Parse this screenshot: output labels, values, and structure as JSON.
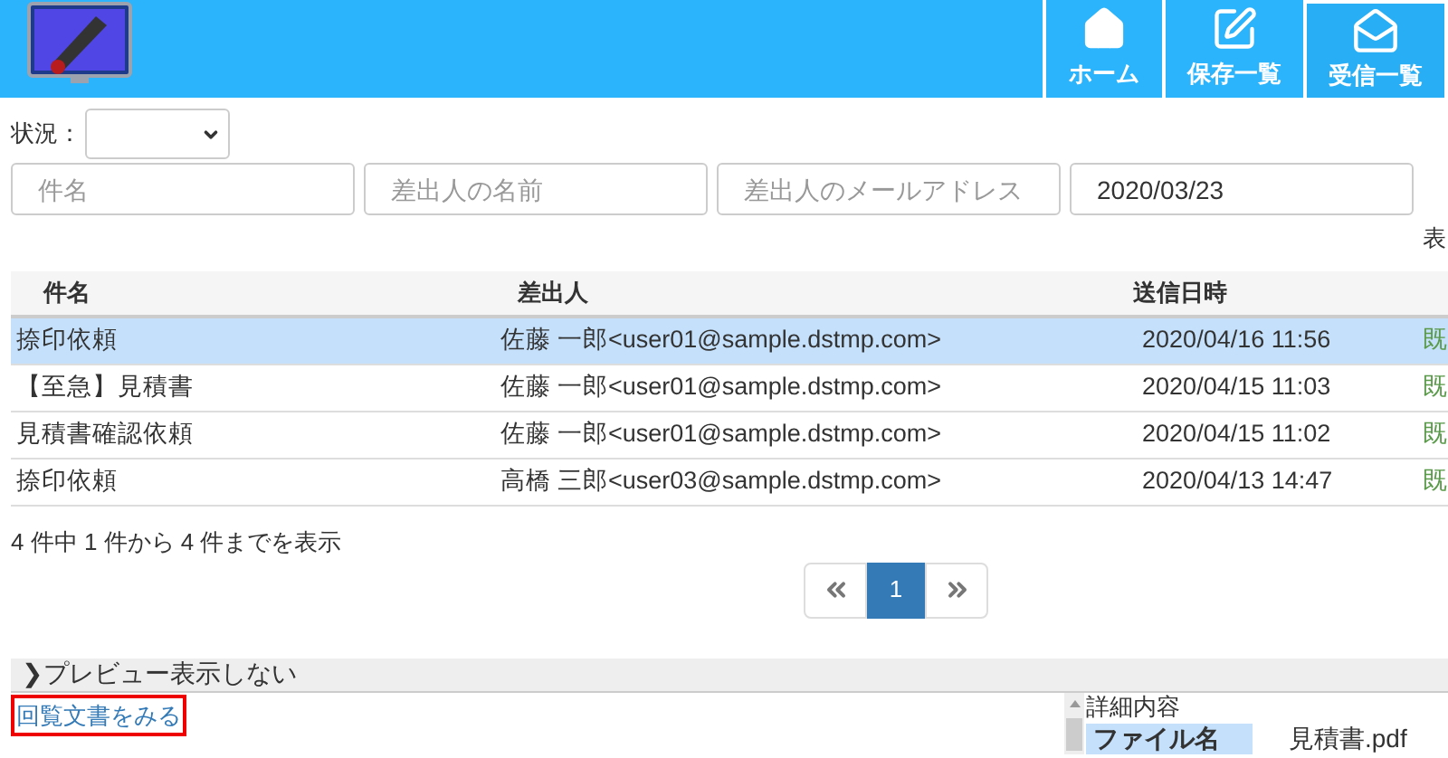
{
  "nav": [
    {
      "kind": "home",
      "label": "ホーム",
      "selected": false
    },
    {
      "kind": "edit",
      "label": "保存一覧",
      "selected": false
    },
    {
      "kind": "inbox",
      "label": "受信一覧",
      "selected": true
    }
  ],
  "status_filter": {
    "label": "状況："
  },
  "search_fields": [
    {
      "placeholder": "件名"
    },
    {
      "placeholder": "差出人の名前"
    },
    {
      "placeholder": "差出人のメールアドレス"
    },
    {
      "value": "2020/03/23"
    }
  ],
  "display_label": "表",
  "table": {
    "columns": [
      "件名",
      "差出人",
      "送信日時"
    ],
    "rows": [
      {
        "subject": "捺印依頼",
        "sender": "佐藤 一郎<user01@sample.dstmp.com>",
        "sent": "2020/04/16 11:56",
        "column_4": "既",
        "selected": true
      },
      {
        "subject": "【至急】見積書",
        "sender": "佐藤 一郎<user01@sample.dstmp.com>",
        "sent": "2020/04/15 11:03",
        "column_4": "既",
        "selected": false
      },
      {
        "subject": "見積書確認依頼",
        "sender": "佐藤 一郎<user01@sample.dstmp.com>",
        "sent": "2020/04/15 11:02",
        "column_4": "既",
        "selected": false
      },
      {
        "subject": "捺印依頼",
        "sender": "高橋 三郎<user03@sample.dstmp.com>",
        "sent": "2020/04/13 14:47",
        "column_4": "既",
        "selected": false
      }
    ]
  },
  "summary": "4 件中 1 件から 4 件までを表示",
  "pagination": {
    "pages": [
      {
        "label": "1",
        "selected": true
      }
    ]
  },
  "preview": {
    "toggle": "❯プレビュー表示しない",
    "link": "回覧文書をみる",
    "details_title": "詳細内容",
    "field_label": "ファイル名",
    "field_value": "見積書.pdf"
  }
}
